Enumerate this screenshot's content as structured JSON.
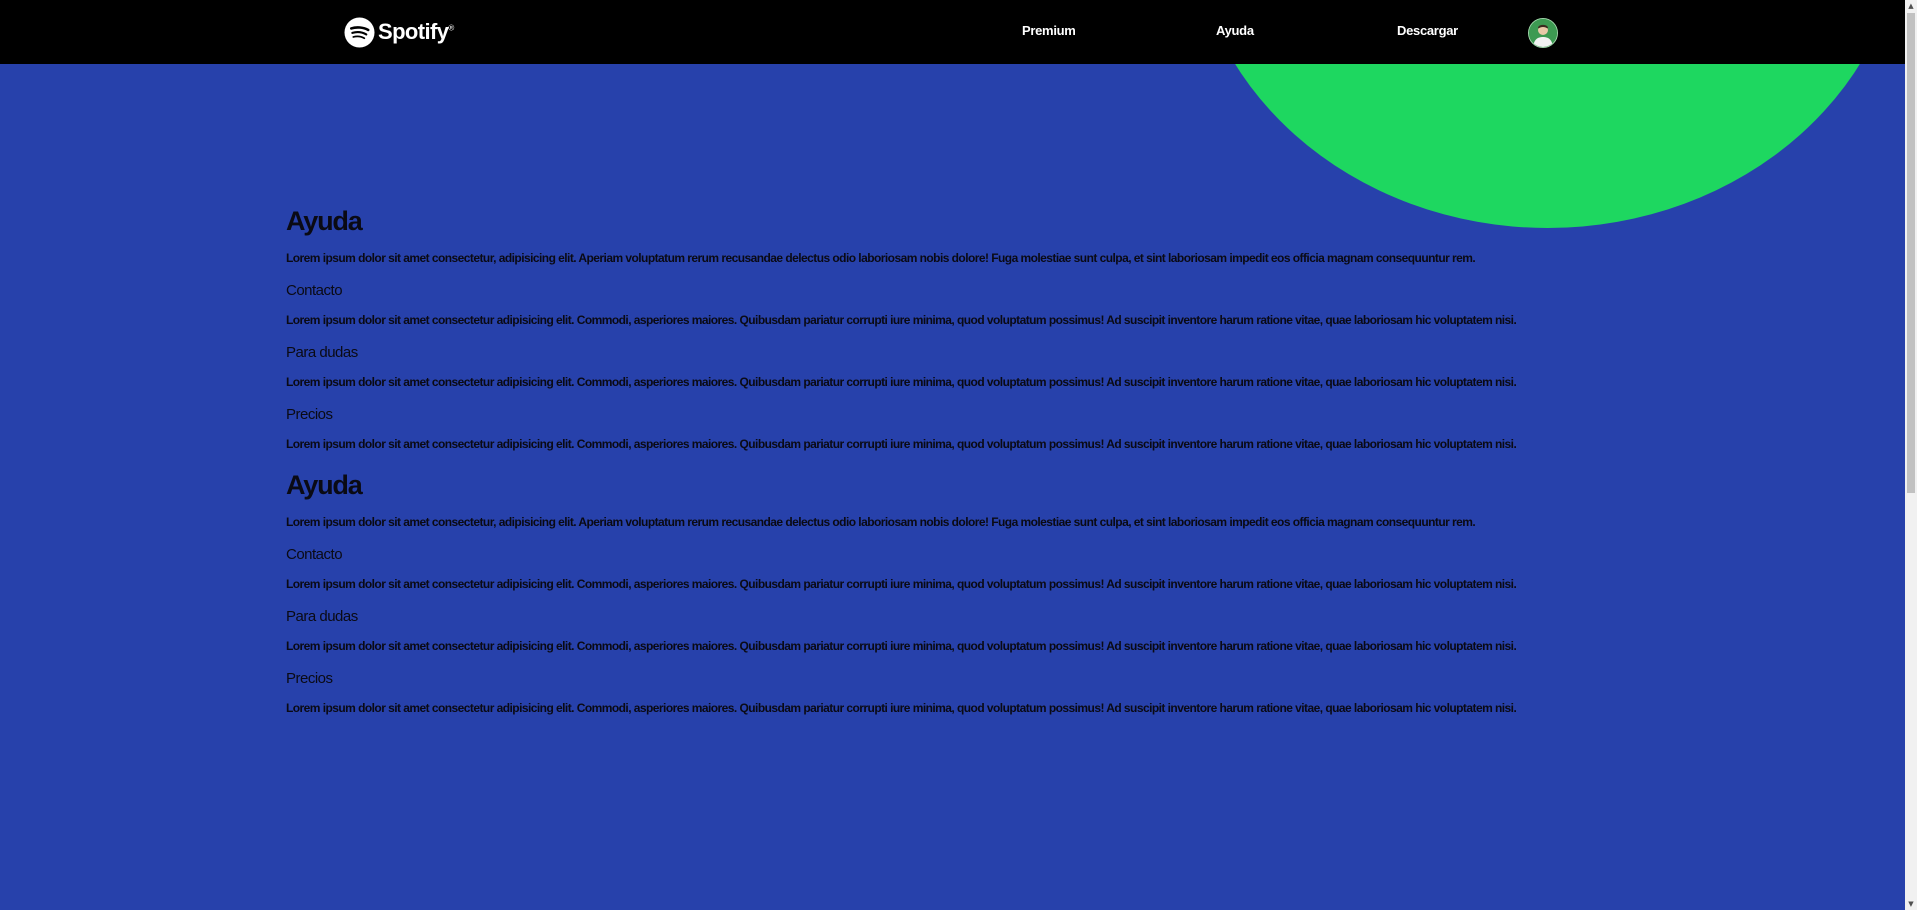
{
  "colors": {
    "background": "#2741ab",
    "navbar": "#000000",
    "accent_circle": "#1ed760",
    "text": "#0a0a14",
    "nav_text": "#ffffff"
  },
  "navbar": {
    "logo_text": "Spotify",
    "logo_mark": "®",
    "links": [
      {
        "label": "Premium",
        "icon": null
      },
      {
        "label": "Ayuda",
        "icon": null
      },
      {
        "label": "Descargar",
        "icon": null
      }
    ],
    "avatar_icon": "user-avatar-icon"
  },
  "sections": [
    {
      "title": "Ayuda",
      "intro": "Lorem ipsum dolor sit amet consectetur, adipisicing elit. Aperiam voluptatum rerum recusandae delectus odio laboriosam nobis dolore! Fuga molestiae sunt culpa, et sint laboriosam impedit eos officia magnam consequuntur rem.",
      "subsections": [
        {
          "heading": "Contacto",
          "text": "Lorem ipsum dolor sit amet consectetur adipisicing elit. Commodi, asperiores maiores. Quibusdam pariatur corrupti iure minima, quod voluptatum possimus! Ad suscipit inventore harum ratione vitae, quae laboriosam hic voluptatem nisi."
        },
        {
          "heading": "Para dudas",
          "text": "Lorem ipsum dolor sit amet consectetur adipisicing elit. Commodi, asperiores maiores. Quibusdam pariatur corrupti iure minima, quod voluptatum possimus! Ad suscipit inventore harum ratione vitae, quae laboriosam hic voluptatem nisi."
        },
        {
          "heading": "Precios",
          "text": "Lorem ipsum dolor sit amet consectetur adipisicing elit. Commodi, asperiores maiores. Quibusdam pariatur corrupti iure minima, quod voluptatum possimus! Ad suscipit inventore harum ratione vitae, quae laboriosam hic voluptatem nisi."
        }
      ]
    },
    {
      "title": "Ayuda",
      "intro": "Lorem ipsum dolor sit amet consectetur, adipisicing elit. Aperiam voluptatum rerum recusandae delectus odio laboriosam nobis dolore! Fuga molestiae sunt culpa, et sint laboriosam impedit eos officia magnam consequuntur rem.",
      "subsections": [
        {
          "heading": "Contacto",
          "text": "Lorem ipsum dolor sit amet consectetur adipisicing elit. Commodi, asperiores maiores. Quibusdam pariatur corrupti iure minima, quod voluptatum possimus! Ad suscipit inventore harum ratione vitae, quae laboriosam hic voluptatem nisi."
        },
        {
          "heading": "Para dudas",
          "text": "Lorem ipsum dolor sit amet consectetur adipisicing elit. Commodi, asperiores maiores. Quibusdam pariatur corrupti iure minima, quod voluptatum possimus! Ad suscipit inventore harum ratione vitae, quae laboriosam hic voluptatem nisi."
        },
        {
          "heading": "Precios",
          "text": "Lorem ipsum dolor sit amet consectetur adipisicing elit. Commodi, asperiores maiores. Quibusdam pariatur corrupti iure minima, quod voluptatum possimus! Ad suscipit inventore harum ratione vitae, quae laboriosam hic voluptatem nisi."
        }
      ]
    }
  ],
  "scrollbar": {
    "up_icon": "scroll-up-arrow-icon",
    "down_icon": "scroll-down-arrow-icon"
  }
}
